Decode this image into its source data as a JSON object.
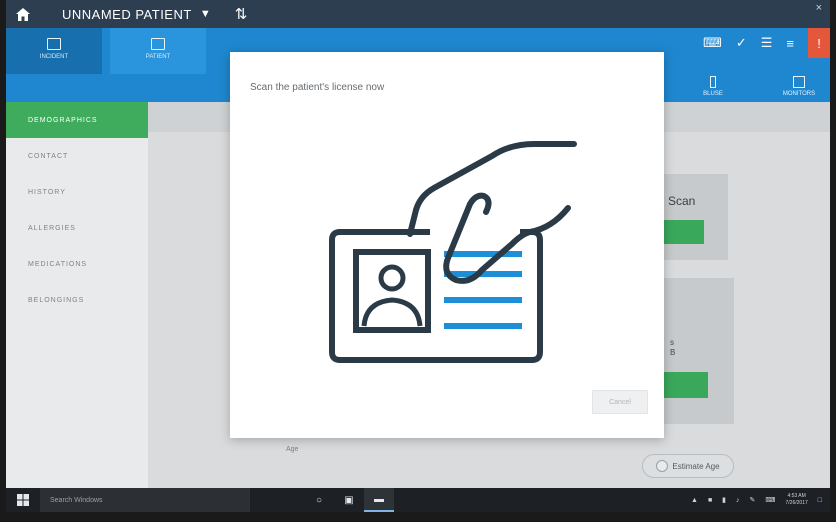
{
  "titlebar": {
    "patient_name": "UNNAMED PATIENT"
  },
  "topnav": {
    "tabs": [
      {
        "label": "INCIDENT"
      },
      {
        "label": "PATIENT"
      }
    ],
    "right_tabs": [
      {
        "label": "BLUSE"
      },
      {
        "label": "MONITORS"
      }
    ]
  },
  "sidebar": {
    "items": [
      {
        "label": "DEMOGRAPHICS"
      },
      {
        "label": "CONTACT"
      },
      {
        "label": "HISTORY"
      },
      {
        "label": "ALLERGIES"
      },
      {
        "label": "MEDICATIONS"
      },
      {
        "label": "BELONGINGS"
      }
    ]
  },
  "main": {
    "scan_label": "Scan",
    "age_label": "Age",
    "estimate_age_label": "Estimate Age",
    "card_text_1": "s",
    "card_text_2": "B"
  },
  "modal": {
    "title": "Scan the patient's license now",
    "cancel_label": "Cancel"
  },
  "taskbar": {
    "search_placeholder": "Search Windows",
    "clock_time": "4:53 AM",
    "clock_date": "7/26/2017"
  },
  "colors": {
    "accent_blue": "#1f87cf",
    "active_green": "#3eac5c",
    "alert_red": "#e4573b",
    "titlebar": "#2d3e50",
    "illustration_dark": "#2b3a47",
    "illustration_blue": "#1c8fd6"
  }
}
